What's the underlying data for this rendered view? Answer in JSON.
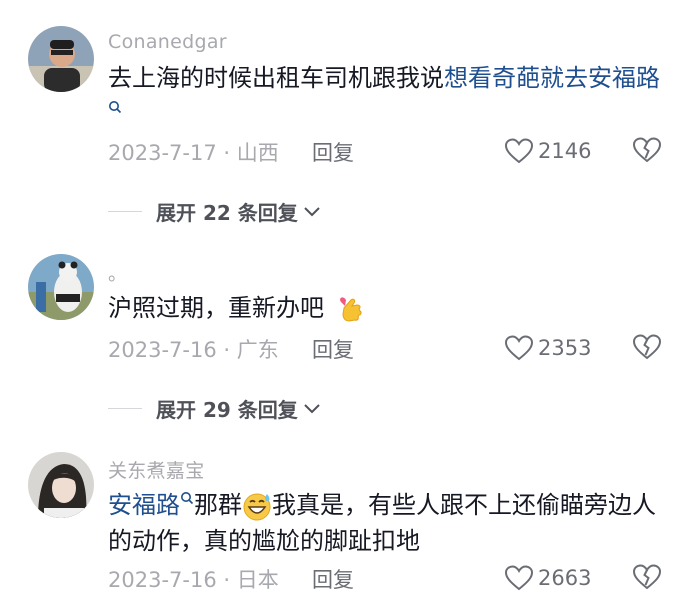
{
  "comments": [
    {
      "username": "Conanedgar",
      "text_before": "去上海的时候出租车司机跟我说",
      "link_text": "想看奇葩就去安福路",
      "date_location": "2023-7-17 · 山西",
      "reply_label": "回复",
      "like_count": "2146",
      "expand_label": "展开 22 条回复"
    },
    {
      "username": "。",
      "text": "沪照过期，重新办吧",
      "emoji": "finger-heart",
      "date_location": "2023-7-16 · 广东",
      "reply_label": "回复",
      "like_count": "2353",
      "expand_label": "展开 29 条回复"
    },
    {
      "username": "关东煮嘉宝",
      "link_text": "安福路",
      "text_mid": "那群",
      "emoji": "grinning-sweat",
      "text_after": "我真是，有些人跟不上还偷瞄旁边人的动作，真的尴尬的脚趾扣地",
      "date_location": "2023-7-16 · 日本",
      "reply_label": "回复",
      "like_count": "2663"
    }
  ],
  "colors": {
    "link": "#1f4f8f",
    "meta": "#a8a9ae",
    "text": "#161823"
  }
}
